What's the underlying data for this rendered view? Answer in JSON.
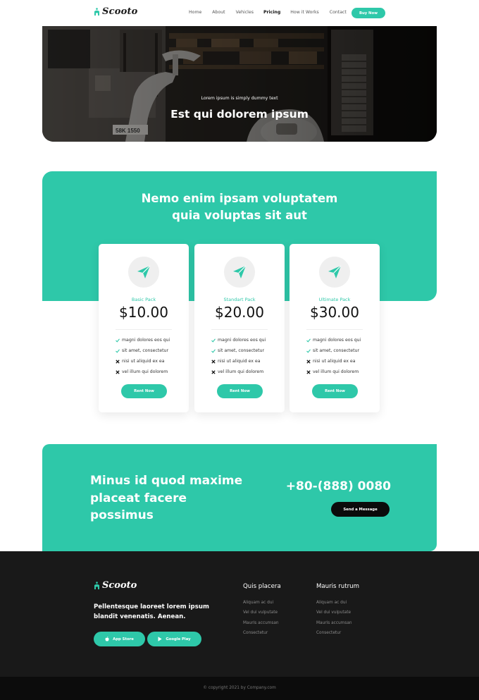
{
  "brand": {
    "name": "Scooto",
    "accent": "#2ec8a9",
    "dark": "#191919"
  },
  "nav": {
    "items": [
      {
        "label": "Home",
        "active": false
      },
      {
        "label": "About",
        "active": false
      },
      {
        "label": "Vehicles",
        "active": false
      },
      {
        "label": "Pricing",
        "active": true
      },
      {
        "label": "How it Works",
        "active": false
      },
      {
        "label": "Contact",
        "active": false
      }
    ],
    "cta": "Buy Now"
  },
  "hero": {
    "kicker": "Lorem ipsum is simply dummy text",
    "title": "Est qui dolorem ipsum",
    "plate": "58K 1550"
  },
  "pricing": {
    "title_line1": "Nemo enim ipsam voluptatem",
    "title_line2": "quia voluptas sit aut",
    "plans": [
      {
        "name": "Basic Pack",
        "price": "$10.00",
        "icon": "paper-plane-icon",
        "button": "Rent Now",
        "features": [
          {
            "text": "magni dolores eos qui",
            "included": true
          },
          {
            "text": "sit amet, consectetur",
            "included": true
          },
          {
            "text": "nisi ut aliquid ex ea",
            "included": false
          },
          {
            "text": "vel illum qui dolorem",
            "included": false
          }
        ]
      },
      {
        "name": "Standart Pack",
        "price": "$20.00",
        "icon": "paper-plane-icon",
        "button": "Rent Now",
        "features": [
          {
            "text": "magni dolores eos qui",
            "included": true
          },
          {
            "text": "sit amet, consectetur",
            "included": true
          },
          {
            "text": "nisi ut aliquid ex ea",
            "included": false
          },
          {
            "text": "vel illum qui dolorem",
            "included": false
          }
        ]
      },
      {
        "name": "Ultimate Pack",
        "price": "$30.00",
        "icon": "paper-plane-icon",
        "button": "Rent Now",
        "features": [
          {
            "text": "magni dolores eos qui",
            "included": true
          },
          {
            "text": "sit amet, consectetur",
            "included": true
          },
          {
            "text": "nisi ut aliquid ex ea",
            "included": false
          },
          {
            "text": "vel illum qui dolorem",
            "included": false
          }
        ]
      }
    ]
  },
  "cta": {
    "line1": "Minus id quod maxime",
    "line2": "placeat facere",
    "line3": "possimus",
    "phone": "+80-(888) 0080",
    "button": "Send a Message"
  },
  "footer": {
    "tagline": "Pellentesque laoreet lorem ipsum blandit venenatis. Aenean.",
    "app_store": "App Store",
    "google_play": "Google Play",
    "columns": [
      {
        "title": "Quis placera",
        "links": [
          "Aliquam ac dui",
          "Vel dui vulputate",
          "Mauris accumsan",
          "Consectetur"
        ]
      },
      {
        "title": "Mauris rutrum",
        "links": [
          "Aliquam ac dui",
          "Vel dui vulputate",
          "Mauris accumsan",
          "Consectetur"
        ]
      }
    ],
    "copyright": "© copyright 2021 by Company.com"
  }
}
